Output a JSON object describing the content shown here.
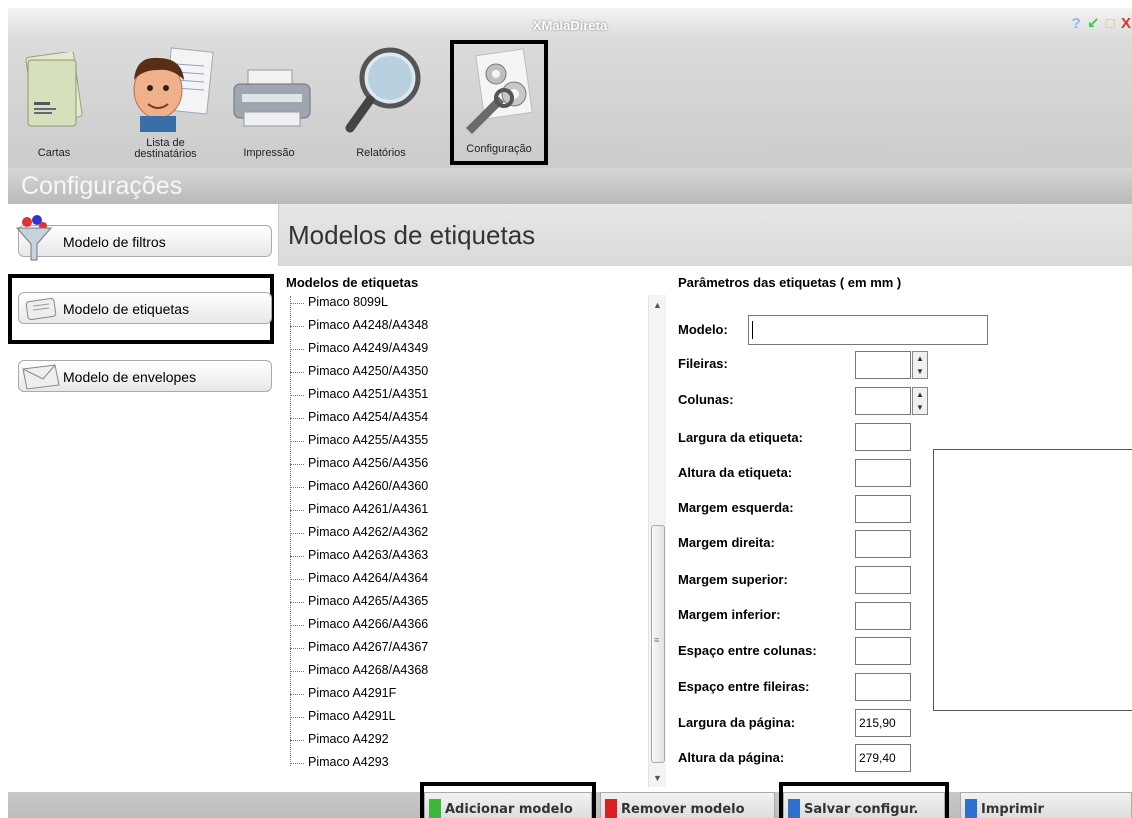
{
  "window": {
    "title": "XMalaDireta",
    "controls": {
      "help": "?",
      "minimize": "↙",
      "maximize": "□",
      "close": "X"
    }
  },
  "toolbar": {
    "items": [
      {
        "label": "Cartas"
      },
      {
        "label": "Lista de destinatários"
      },
      {
        "label": "Impressão"
      },
      {
        "label": "Relatórios"
      },
      {
        "label": "Configuração"
      }
    ]
  },
  "section": {
    "title": "Configurações"
  },
  "nav": {
    "items": [
      {
        "label": "Modelo de filtros"
      },
      {
        "label": "Modelo de etiquetas"
      },
      {
        "label": "Modelo de envelopes"
      }
    ]
  },
  "main": {
    "title": "Modelos de etiquetas",
    "list_heading": "Modelos de etiquetas",
    "params_heading": "Parâmetros das etiquetas  ( em mm )",
    "models": [
      "Pimaco 8099L",
      "Pimaco A4248/A4348",
      "Pimaco A4249/A4349",
      "Pimaco A4250/A4350",
      "Pimaco A4251/A4351",
      "Pimaco A4254/A4354",
      "Pimaco A4255/A4355",
      "Pimaco A4256/A4356",
      "Pimaco A4260/A4360",
      "Pimaco A4261/A4361",
      "Pimaco A4262/A4362",
      "Pimaco A4263/A4363",
      "Pimaco A4264/A4364",
      "Pimaco A4265/A4365",
      "Pimaco A4266/A4366",
      "Pimaco A4267/A4367",
      "Pimaco A4268/A4368",
      "Pimaco A4291F",
      "Pimaco A4291L",
      "Pimaco A4292",
      "Pimaco A4293"
    ],
    "fields": {
      "modelo": {
        "label": "Modelo:",
        "value": ""
      },
      "fileiras": {
        "label": "Fileiras:",
        "value": ""
      },
      "colunas": {
        "label": "Colunas:",
        "value": ""
      },
      "largura_etiqueta": {
        "label": "Largura da etiqueta:",
        "value": ""
      },
      "altura_etiqueta": {
        "label": "Altura da etiqueta:",
        "value": ""
      },
      "margem_esquerda": {
        "label": "Margem esquerda:",
        "value": ""
      },
      "margem_direita": {
        "label": "Margem direita:",
        "value": ""
      },
      "margem_superior": {
        "label": "Margem superior:",
        "value": ""
      },
      "margem_inferior": {
        "label": "Margem inferior:",
        "value": ""
      },
      "espaco_colunas": {
        "label": "Espaço entre colunas:",
        "value": ""
      },
      "espaco_fileiras": {
        "label": "Espaço entre fileiras:",
        "value": ""
      },
      "largura_pagina": {
        "label": "Largura da página:",
        "value": "215,90"
      },
      "altura_pagina": {
        "label": "Altura da página:",
        "value": "279,40"
      }
    }
  },
  "bottom": {
    "add": {
      "label": "Adicionar modelo",
      "color": "#3cb83c"
    },
    "remove": {
      "label": "Remover modelo",
      "color": "#d82020"
    },
    "save": {
      "label": "Salvar configur.",
      "color": "#2f6fd0"
    },
    "print": {
      "label": "Imprimir",
      "color": "#2f6fd0"
    }
  }
}
